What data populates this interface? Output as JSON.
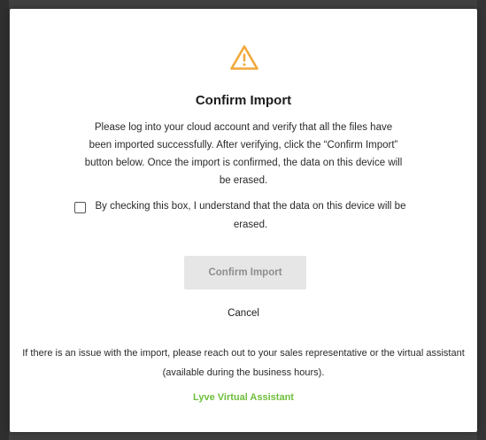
{
  "modal": {
    "title": "Confirm Import",
    "description": "Please log into your cloud account and verify that all the files have been imported successfully. After verifying, click the “Confirm Import” button below. Once the import is confirmed, the data on this device will be erased.",
    "checkbox_label": "By checking this box, I understand that the data on this device will be erased.",
    "checkbox_checked": false,
    "confirm_button": "Confirm Import",
    "confirm_button_disabled": true,
    "cancel_button": "Cancel",
    "issue_text": "If there is an issue with the import, please reach out to your sales representative or the virtual assistant (available during the business hours).",
    "assistant_link": "Lyve Virtual Assistant"
  },
  "icons": {
    "warning": "warning-triangle-icon"
  },
  "colors": {
    "warning": "#f2a93b",
    "link": "#6ebe3b",
    "disabled_button_bg": "#e6e6e6",
    "disabled_button_text": "#8e8e8e",
    "backdrop": "#404040"
  }
}
